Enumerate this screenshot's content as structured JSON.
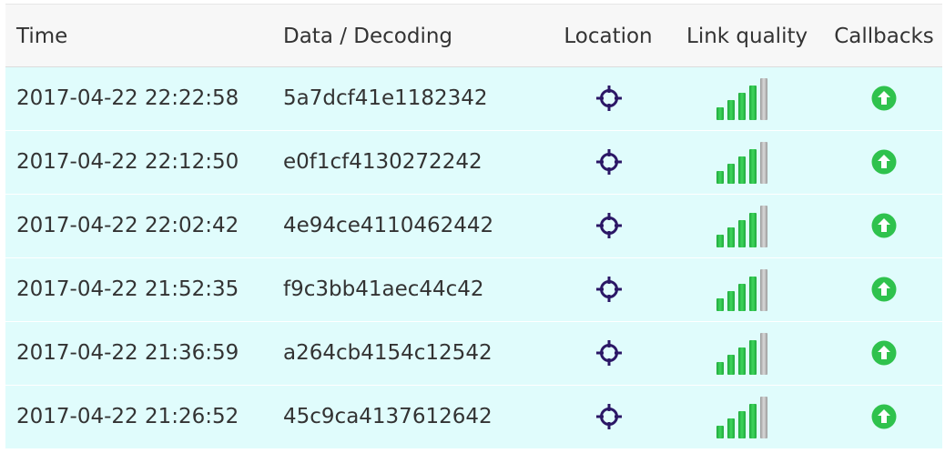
{
  "table": {
    "columns": {
      "time": "Time",
      "data": "Data / Decoding",
      "location": "Location",
      "link_quality": "Link quality",
      "callbacks": "Callbacks"
    },
    "rows": [
      {
        "time": "2017-04-22 22:22:58",
        "data": "5a7dcf41e1182342",
        "location_icon": "crosshair-icon",
        "link_quality_bars": 4,
        "link_quality_max": 5,
        "callback_icon": "arrow-up-circle-icon"
      },
      {
        "time": "2017-04-22 22:12:50",
        "data": "e0f1cf4130272242",
        "location_icon": "crosshair-icon",
        "link_quality_bars": 4,
        "link_quality_max": 5,
        "callback_icon": "arrow-up-circle-icon"
      },
      {
        "time": "2017-04-22 22:02:42",
        "data": "4e94ce4110462442",
        "location_icon": "crosshair-icon",
        "link_quality_bars": 4,
        "link_quality_max": 5,
        "callback_icon": "arrow-up-circle-icon"
      },
      {
        "time": "2017-04-22 21:52:35",
        "data": "f9c3bb41aec44c42",
        "location_icon": "crosshair-icon",
        "link_quality_bars": 4,
        "link_quality_max": 5,
        "callback_icon": "arrow-up-circle-icon"
      },
      {
        "time": "2017-04-22 21:36:59",
        "data": "a264cb4154c12542",
        "location_icon": "crosshair-icon",
        "link_quality_bars": 4,
        "link_quality_max": 5,
        "callback_icon": "arrow-up-circle-icon"
      },
      {
        "time": "2017-04-22 21:26:52",
        "data": "45c9ca4137612642",
        "location_icon": "crosshair-icon",
        "link_quality_bars": 4,
        "link_quality_max": 5,
        "callback_icon": "arrow-up-circle-icon"
      }
    ]
  },
  "colors": {
    "row_background": "#e0fcfc",
    "header_background": "#f7f7f7",
    "text": "#333333",
    "location_icon": "#2b1766",
    "signal_active": "#2fc24d",
    "signal_inactive": "#bdbdbd",
    "callback_icon": "#2fc24d"
  }
}
